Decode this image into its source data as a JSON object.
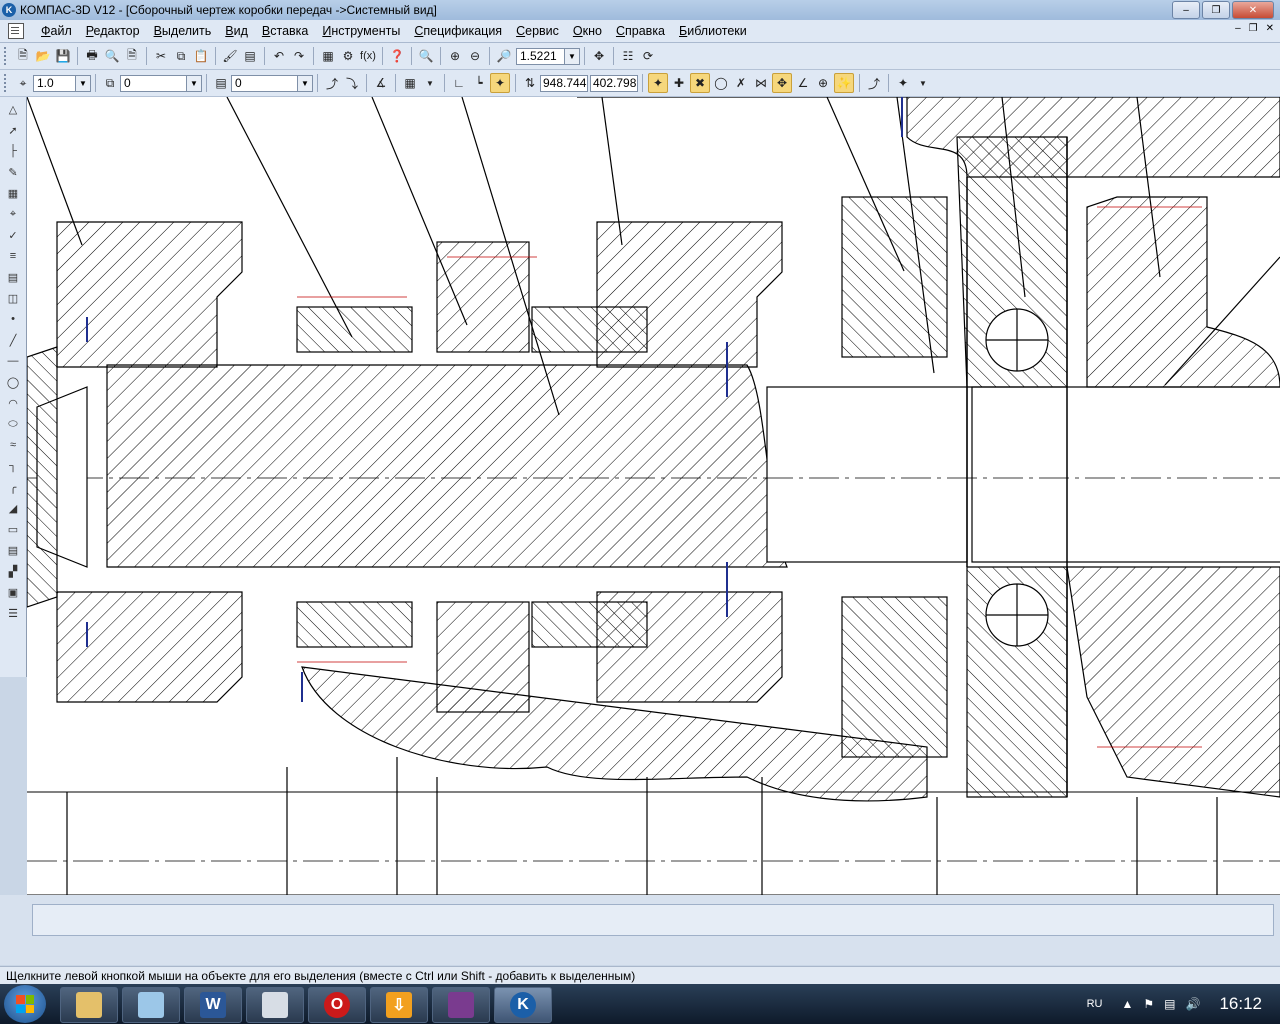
{
  "window": {
    "title": "КОМПАС-3D V12 - [Сборочный чертеж коробки передач ->Системный вид]",
    "app_icon_letter": "K"
  },
  "menu": {
    "items": [
      "Файл",
      "Редактор",
      "Выделить",
      "Вид",
      "Вставка",
      "Инструменты",
      "Спецификация",
      "Сервис",
      "Окно",
      "Справка",
      "Библиотеки"
    ]
  },
  "toolbar1": {
    "zoom_value": "1.5221",
    "fx_label": "f(x)"
  },
  "toolbar2": {
    "line_scale": "1.0",
    "layer_state": "0",
    "layer": "0",
    "coord_x": "948.744",
    "coord_y": "402.798"
  },
  "drawing": {
    "view_name": "Системный вид",
    "line_color": "#000000",
    "accent_color": "#1f2f8f",
    "axis_color": "#c00000"
  },
  "statusbar": {
    "hint": "Щелкните левой кнопкой мыши на объекте для его выделения (вместе с Ctrl или Shift - добавить к выделенным)"
  },
  "taskbar": {
    "apps": [
      "explorer",
      "libraries",
      "word",
      "calculator",
      "opera",
      "downloader",
      "winrar",
      "kompas"
    ],
    "active_app": "kompas",
    "word_letter": "W",
    "opera_letter": "O",
    "kompas_letter": "K",
    "language": "RU",
    "clock": "16:12"
  }
}
